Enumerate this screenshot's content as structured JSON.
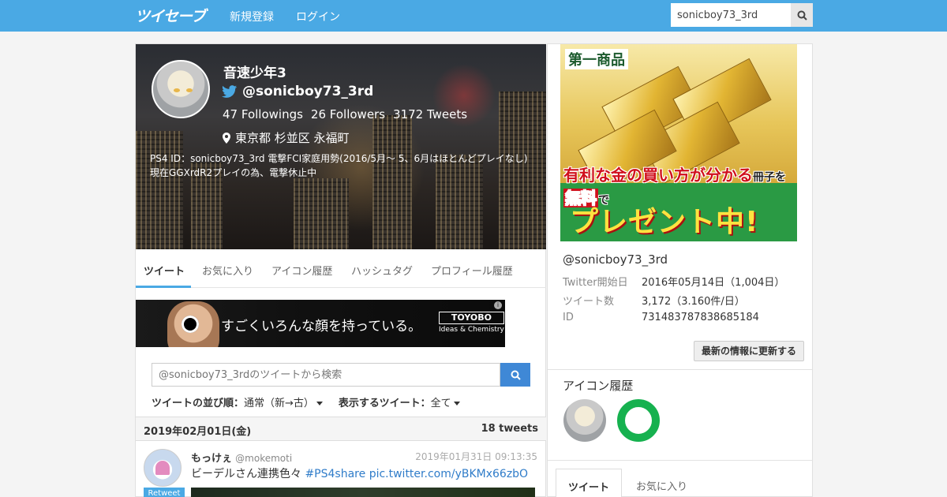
{
  "header": {
    "logo": "ツイセーブ",
    "nav": [
      "新規登録",
      "ログイン"
    ],
    "search_value": "sonicboy73_3rd"
  },
  "profile": {
    "name": "音速少年3",
    "handle": "@sonicboy73_3rd",
    "followings": "47 Followings",
    "followers": "26 Followers",
    "tweets": "3172 Tweets",
    "location": "東京都 杉並区 永福町",
    "bio": "PS4 ID：sonicboy73_3rd 電撃FCI家庭用勢(2016/5月～ 5、6月はほとんどプレイなし) 現在GGXrdR2プレイの為、電撃休止中"
  },
  "tabs": [
    "ツイート",
    "お気に入り",
    "アイコン履歴",
    "ハッシュタグ",
    "プロフィール履歴"
  ],
  "ad1": {
    "text": "すごくいろんな顔を持っている。",
    "logo": "TOYOBO",
    "logo_sub": "Ideas & Chemistry",
    "info": "i"
  },
  "tweet_search": {
    "placeholder": "@sonicboy73_3rdのツイートから検索"
  },
  "sort": {
    "order_label": "ツイートの並び順：",
    "order_value": "通常（新→古）",
    "show_label": "表示するツイート：",
    "show_value": "全て"
  },
  "date_header": {
    "date": "2019年02月01日(金)",
    "count": "18 tweets"
  },
  "tweet": {
    "name": "もっけぇ",
    "handle": "@mokemoti",
    "time": "2019年01月31日 09:13:35",
    "text": "ビーデルさん連携色々 ",
    "hashtag": "#PS4share",
    "link": "pic.twitter.com/yBKMx66zbO",
    "retweet_badge": "Retweet"
  },
  "sidebar_ad": {
    "brand": "第一商品",
    "line1_a": "有利な",
    "line1_b": "金",
    "line1_c": "の",
    "line1_d": "買い方が分かる",
    "line1_e": "冊子を",
    "line1_f": "無料",
    "line1_g": "で",
    "line2": "プレゼント中!"
  },
  "sidebar": {
    "handle": "@sonicboy73_3rd",
    "rows": [
      {
        "key": "Twitter開始日",
        "value": "2016年05月14日（1,004日）"
      },
      {
        "key": "ツイート数",
        "value": "3,172（3.160件/日）"
      },
      {
        "key": "ID",
        "value": "731483787838685184"
      }
    ],
    "update_button": "最新の情報に更新する",
    "icon_history_title": "アイコン履歴",
    "tabs": [
      "ツイート",
      "お気に入り"
    ]
  },
  "colors": {
    "brand": "#4aa9e4",
    "link": "#2f7cc9",
    "button": "#3f88d6"
  }
}
